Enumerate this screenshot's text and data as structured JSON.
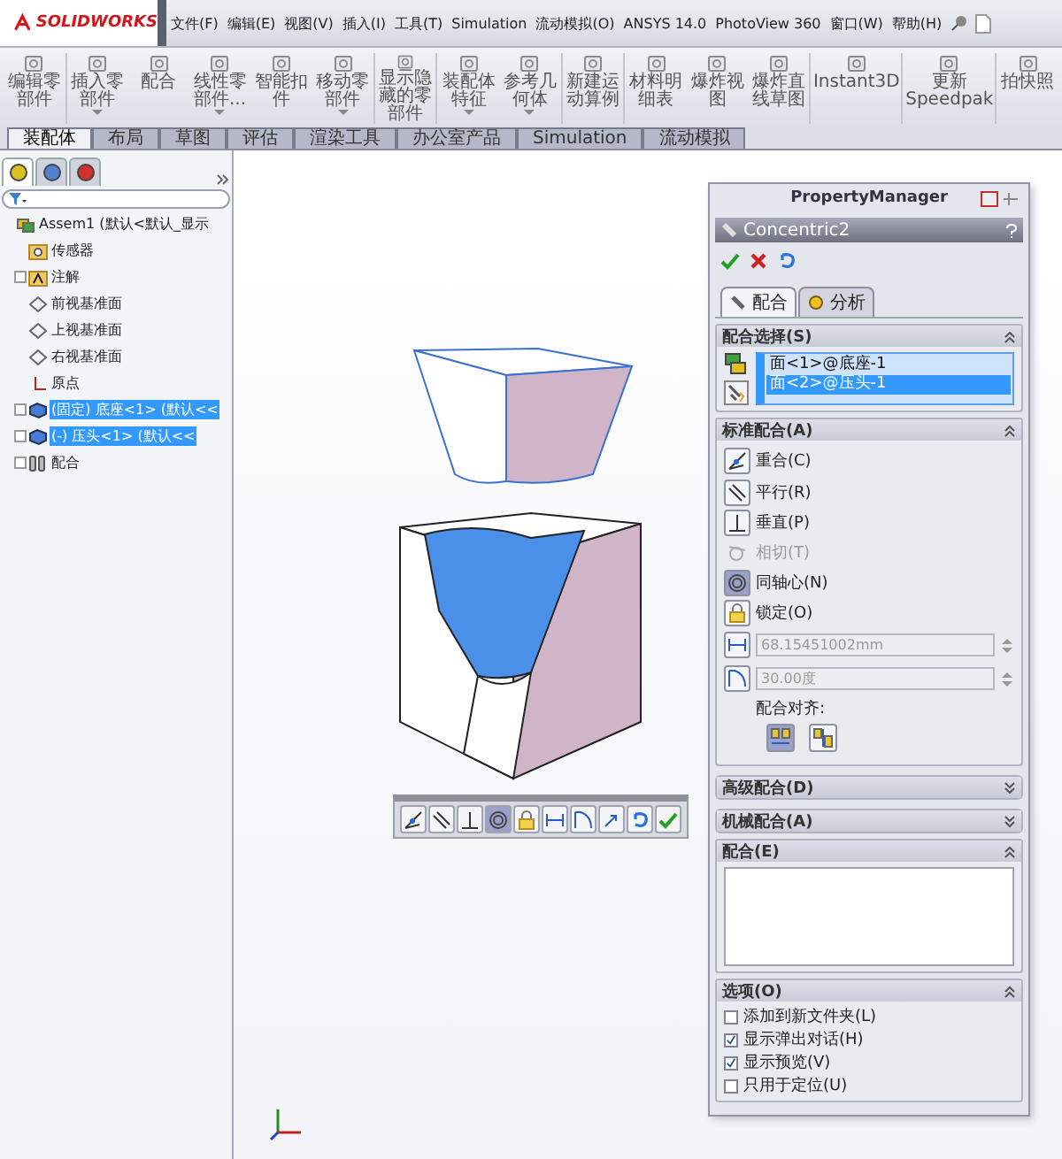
{
  "app": {
    "logo": "SOLIDWORKS"
  },
  "menus": [
    "文件(F)",
    "编辑(E)",
    "视图(V)",
    "插入(I)",
    "工具(T)",
    "Simulation",
    "流动模拟(O)",
    "ANSYS 14.0",
    "PhotoView 360",
    "窗口(W)",
    "帮助(H)"
  ],
  "ribbon": [
    {
      "label": "编辑零部件",
      "dropdown": false
    },
    {
      "label": "插入零部件",
      "dropdown": true
    },
    {
      "label": "配合",
      "dropdown": false
    },
    {
      "label": "线性零部件...",
      "dropdown": true
    },
    {
      "label": "智能扣件",
      "dropdown": false
    },
    {
      "label": "移动零部件",
      "dropdown": true
    },
    {
      "label": "显示隐藏的零部件",
      "dropdown": false
    },
    {
      "label": "装配体特征",
      "dropdown": true
    },
    {
      "label": "参考几何体",
      "dropdown": true
    },
    {
      "label": "新建运动算例",
      "dropdown": false
    },
    {
      "label": "材料明细表",
      "dropdown": false
    },
    {
      "label": "爆炸视图",
      "dropdown": false
    },
    {
      "label": "爆炸直线草图",
      "dropdown": false
    },
    {
      "label": "Instant3D",
      "dropdown": false
    },
    {
      "label": "更新Speedpak",
      "dropdown": false
    },
    {
      "label": "拍快照",
      "dropdown": false
    }
  ],
  "command_tabs": [
    {
      "label": "装配体",
      "selected": true
    },
    {
      "label": "布局",
      "selected": false
    },
    {
      "label": "草图",
      "selected": false
    },
    {
      "label": "评估",
      "selected": false
    },
    {
      "label": "渲染工具",
      "selected": false
    },
    {
      "label": "办公室产品",
      "selected": false
    },
    {
      "label": "Simulation",
      "selected": false
    },
    {
      "label": "流动模拟",
      "selected": false
    }
  ],
  "feature_manager": {
    "tabs": [
      {
        "kind": "tree",
        "selected": true
      },
      {
        "kind": "config",
        "selected": false
      },
      {
        "kind": "display",
        "selected": false
      }
    ],
    "tree": {
      "label": "Assem1 (默认<默认_显示",
      "kind": "assembly",
      "expandable": false,
      "selected": false,
      "children": [
        {
          "label": "传感器",
          "kind": "sensor",
          "expandable": false,
          "selected": false
        },
        {
          "label": "注解",
          "kind": "annotation",
          "expandable": true,
          "selected": false
        },
        {
          "label": "前视基准面",
          "kind": "plane",
          "expandable": false,
          "selected": false
        },
        {
          "label": "上视基准面",
          "kind": "plane",
          "expandable": false,
          "selected": false
        },
        {
          "label": "右视基准面",
          "kind": "plane",
          "expandable": false,
          "selected": false
        },
        {
          "label": "原点",
          "kind": "origin",
          "expandable": false,
          "selected": false
        },
        {
          "label": "(固定) 底座<1> (默认<<",
          "kind": "part",
          "expandable": true,
          "selected": true
        },
        {
          "label": "(-) 压头<1> (默认<<",
          "kind": "part",
          "expandable": true,
          "selected": true
        },
        {
          "label": "配合",
          "kind": "mates",
          "expandable": true,
          "selected": false
        }
      ]
    }
  },
  "property_manager": {
    "title": "PropertyManager",
    "mate_name": "Concentric2",
    "tabs": [
      {
        "label": "配合",
        "kind": "mate",
        "selected": true
      },
      {
        "label": "分析",
        "kind": "analysis",
        "selected": false
      }
    ],
    "sections": [
      {
        "kind": "selection",
        "title": "配合选择(S)",
        "expanded": true,
        "items": [
          {
            "label": "面<1>@底座-1",
            "selected": false
          },
          {
            "label": "面<2>@压头-1",
            "selected": true
          }
        ]
      },
      {
        "kind": "standard",
        "title": "标准配合(A)",
        "expanded": true,
        "mate_types": [
          {
            "kind": "coincident",
            "label": "重合(C)",
            "selected": false,
            "disabled": false
          },
          {
            "kind": "parallel",
            "label": "平行(R)",
            "selected": false,
            "disabled": false
          },
          {
            "kind": "perpendicular",
            "label": "垂直(P)",
            "selected": false,
            "disabled": false
          },
          {
            "kind": "tangent",
            "label": "相切(T)",
            "selected": false,
            "disabled": true
          },
          {
            "kind": "concentric",
            "label": "同轴心(N)",
            "selected": true,
            "disabled": false
          },
          {
            "kind": "lock",
            "label": "锁定(O)",
            "selected": false,
            "disabled": false
          }
        ],
        "distance": "68.15451002mm",
        "angle": "30.00度",
        "alignment": {
          "label": "配合对齐:",
          "options": [
            {
              "kind": "aligned",
              "selected": true
            },
            {
              "kind": "anti",
              "selected": false
            }
          ]
        }
      },
      {
        "kind": "plain",
        "title": "高级配合(D)",
        "expanded": false
      },
      {
        "kind": "plain",
        "title": "机械配合(A)",
        "expanded": false
      },
      {
        "kind": "list",
        "title": "配合(E)",
        "expanded": true
      },
      {
        "kind": "options",
        "title": "选项(O)",
        "expanded": true,
        "options": [
          {
            "label": "添加到新文件夹(L)",
            "checked": false
          },
          {
            "label": "显示弹出对话(H)",
            "checked": true
          },
          {
            "label": "显示预览(V)",
            "checked": true
          },
          {
            "label": "只用于定位(U)",
            "checked": false
          }
        ]
      }
    ]
  },
  "popup_toolbar": [
    {
      "kind": "coincident",
      "selected": false
    },
    {
      "kind": "parallel",
      "selected": false
    },
    {
      "kind": "perpendicular",
      "selected": false
    },
    {
      "kind": "concentric",
      "selected": true
    },
    {
      "kind": "lock",
      "selected": false
    },
    {
      "kind": "distance",
      "selected": false
    },
    {
      "kind": "angle",
      "selected": false
    },
    {
      "kind": "flip",
      "selected": false
    },
    {
      "kind": "undo",
      "selected": false
    },
    {
      "kind": "ok",
      "selected": false
    }
  ]
}
